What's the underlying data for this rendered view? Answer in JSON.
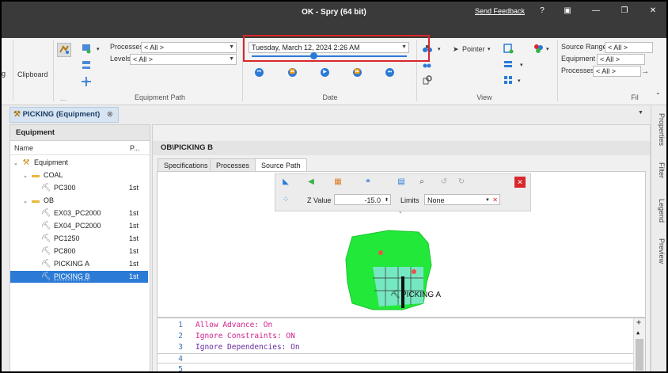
{
  "window": {
    "title": "OK - Spry (64 bit)",
    "send_feedback": "Send Feedback",
    "help_icon": "?",
    "restore_icon": "▣",
    "minimize_icon": "—",
    "maximize_icon": "❐",
    "close_icon": "✕"
  },
  "ribbon": {
    "clipboard_label": "Clipboard",
    "more_label": "...",
    "equipment_path_label": "Equipment Path",
    "processes_label": "Processes",
    "processes_value": "< All >",
    "levels_label": "Levels",
    "levels_value": "< All >",
    "date_group_label": "Date",
    "date_value": "Tuesday, March 12, 2024 2:26 AM",
    "date_slider_fraction": 0.4,
    "view_group_label": "View",
    "pointer_label": "Pointer",
    "filter_group_label": "Fil",
    "source_range_label": "Source Range",
    "source_range_value": "< All >",
    "equipment_label": "Equipment",
    "equipment_value": "< All >",
    "filter_processes_label": "Processes",
    "filter_processes_value": "< All >",
    "accent_color": "#2b7bd6",
    "highlight_color": "#d9262b"
  },
  "document_tab": {
    "label": "PICKING (Equipment)",
    "close_icon": "⊗"
  },
  "side_tabs": [
    "Properties",
    "Filter",
    "Legend",
    "Preview"
  ],
  "equipment_panel": {
    "title": "Equipment",
    "col_name": "Name",
    "col_p": "P...",
    "tree": [
      {
        "label": "Equipment",
        "level": 0,
        "icon": "equipment-root-icon",
        "expanded": true,
        "p": ""
      },
      {
        "label": "COAL",
        "level": 1,
        "icon": "folder-icon",
        "expanded": true,
        "p": ""
      },
      {
        "label": "PC300",
        "level": 2,
        "icon": "excavator-icon",
        "p": "1st"
      },
      {
        "label": "OB",
        "level": 1,
        "icon": "folder-icon",
        "expanded": true,
        "p": ""
      },
      {
        "label": "EX03_PC2000",
        "level": 2,
        "icon": "excavator-icon",
        "p": "1st"
      },
      {
        "label": "EX04_PC2000",
        "level": 2,
        "icon": "excavator-icon",
        "p": "1st"
      },
      {
        "label": "PC1250",
        "level": 2,
        "icon": "excavator-icon",
        "p": "1st"
      },
      {
        "label": "PC800",
        "level": 2,
        "icon": "excavator-icon",
        "p": "1st"
      },
      {
        "label": "PICKING A",
        "level": 2,
        "icon": "excavator-icon",
        "p": "1st"
      },
      {
        "label": "PICKING B",
        "level": 2,
        "icon": "excavator-icon",
        "p": "1st",
        "selected": true
      }
    ]
  },
  "main_panel": {
    "path_title": "OB\\PICKING B",
    "tabs": [
      "Specifications",
      "Processes",
      "Source Path"
    ],
    "active_tab": "Source Path",
    "z_value_label": "Z Value",
    "z_value": "-15.0",
    "limits_label": "Limits",
    "limits_value": "None",
    "viewport_label": "PICKING A"
  },
  "editor": {
    "lines": [
      {
        "n": "1",
        "text": "Allow Advance: On"
      },
      {
        "n": "2",
        "text": "Ignore Constraints: ON"
      },
      {
        "n": "3",
        "text": "Ignore Dependencies: On"
      },
      {
        "n": "4",
        "text": ""
      },
      {
        "n": "5",
        "text": ""
      }
    ]
  }
}
